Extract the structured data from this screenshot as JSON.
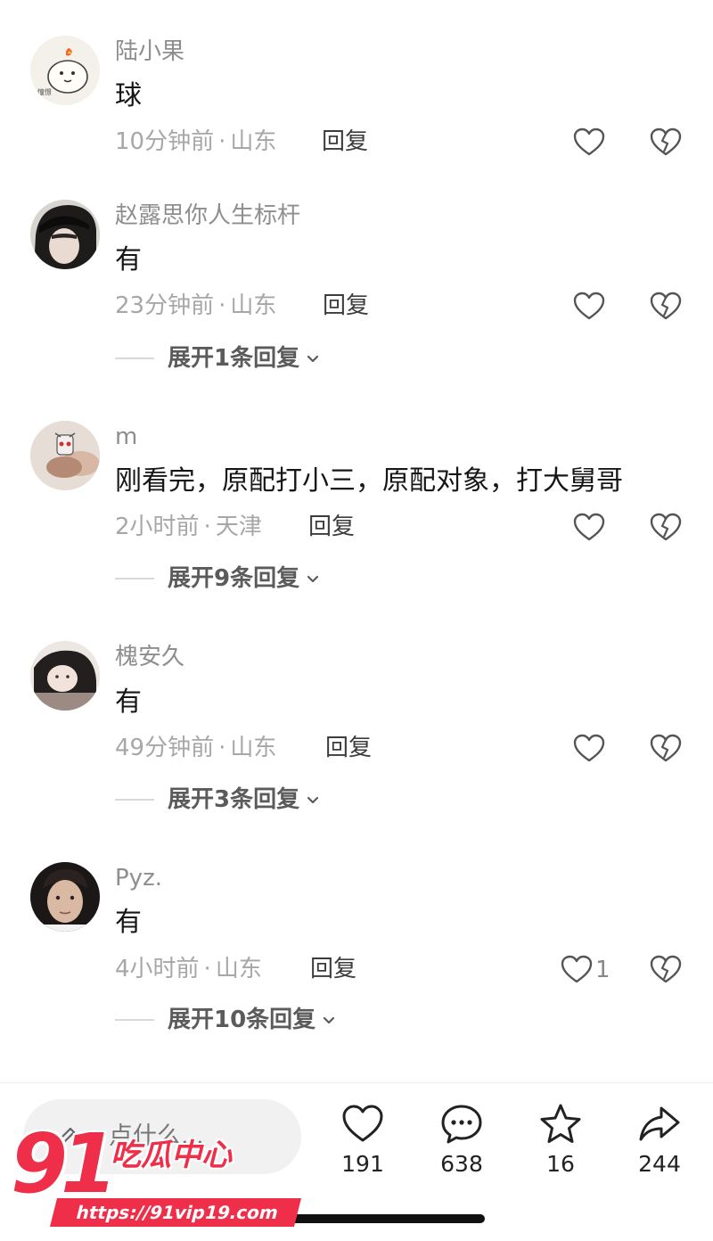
{
  "comments": [
    {
      "username": "陆小果",
      "text": "球",
      "time": "10分钟前",
      "location": "山东",
      "sep": "·",
      "reply": "回复",
      "likes": "",
      "expand": "",
      "avatar": "cartoon-chicken-avatar"
    },
    {
      "username": "赵露思你人生标杆",
      "text": "有",
      "time": "23分钟前",
      "location": "山东",
      "sep": "·",
      "reply": "回复",
      "likes": "",
      "expand": "展开1条回复",
      "avatar": "girl-cap-avatar"
    },
    {
      "username": "m",
      "text": "刚看完，原配打小三，原配对象，打大舅哥",
      "time": "2小时前",
      "location": "天津",
      "sep": "·",
      "reply": "回复",
      "likes": "",
      "expand": "展开9条回复",
      "avatar": "figurine-avatar"
    },
    {
      "username": "槐安久",
      "text": "有",
      "time": "49分钟前",
      "location": "山东",
      "sep": "·",
      "reply": "回复",
      "likes": "",
      "expand": "展开3条回复",
      "avatar": "girl-lying-avatar"
    },
    {
      "username": "Pyz.",
      "text": "有",
      "time": "4小时前",
      "location": "山东",
      "sep": "·",
      "reply": "回复",
      "likes": "1",
      "expand": "展开10条回复",
      "avatar": "young-man-avatar"
    }
  ],
  "bottom_bar": {
    "input_placeholder": "点什么...",
    "likes": "191",
    "comments": "638",
    "favorites": "16",
    "shares": "244"
  },
  "watermark": {
    "number": "91",
    "name": "吃瓜中心",
    "url": "https://91vip19.com"
  },
  "colors": {
    "accent": "#ef2f4a",
    "meta": "#a7a7a7",
    "username": "#8e8e8e"
  }
}
